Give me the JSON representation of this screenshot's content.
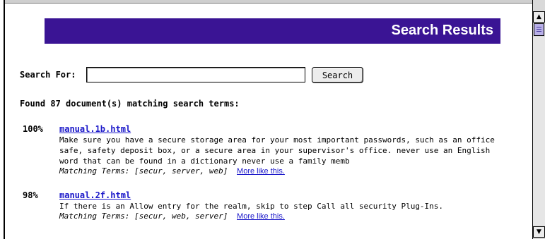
{
  "page": {
    "banner_title": "Search Results",
    "accent_color": "#3a1494",
    "link_color": "#1a17c9"
  },
  "search": {
    "label": "Search For:",
    "value": "",
    "button_label": "Search"
  },
  "summary": "Found 87 document(s) matching search terms:",
  "results": [
    {
      "score": "100%",
      "link": "manual.1b.html",
      "snippet": "Make sure you have a secure storage area for your most important passwords, such as an office safe, safety deposit box, or a secure area in your supervisor's office. never use an English word that can be found in a dictionary never use a family memb",
      "terms_label": "Matching Terms:",
      "terms": "[secur, server, web]",
      "more_label": "More like this."
    },
    {
      "score": "98%",
      "link": "manual.2f.html",
      "snippet": "If there is an Allow entry for the realm, skip to step Call all security Plug-Ins.",
      "terms_label": "Matching Terms:",
      "terms": "[secur, web, server]",
      "more_label": "More like this."
    }
  ],
  "scrollbar": {
    "up_icon": "up-arrow-icon",
    "down_icon": "down-arrow-icon"
  }
}
